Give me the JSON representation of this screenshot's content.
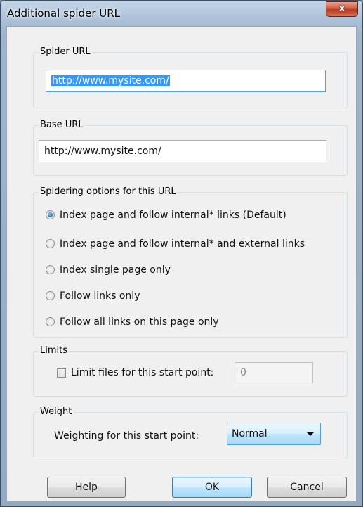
{
  "window": {
    "title": "Additional spider URL",
    "close_label": "x"
  },
  "spider_url": {
    "group_label": "Spider URL",
    "value": "http://www.mysite.com/"
  },
  "base_url": {
    "group_label": "Base URL",
    "value": "http://www.mysite.com/"
  },
  "spidering_options": {
    "group_label": "Spidering options for this URL",
    "selected_index": 0,
    "options": [
      "Index page and follow internal* links (Default)",
      "Index page and follow internal* and external links",
      "Index single page only",
      "Follow links only",
      "Follow all links on this page only"
    ]
  },
  "limits": {
    "group_label": "Limits",
    "checkbox_label": "Limit files for this start point:",
    "checked": false,
    "value": "0"
  },
  "weight": {
    "group_label": "Weight",
    "label": "Weighting for this start point:",
    "selected": "Normal"
  },
  "buttons": {
    "help": "Help",
    "ok": "OK",
    "cancel": "Cancel"
  },
  "colors": {
    "selection": "#3399ff",
    "focus_border": "#569de5",
    "dialog_bg": "#f0f0f0",
    "close_button": "#c9462c"
  }
}
